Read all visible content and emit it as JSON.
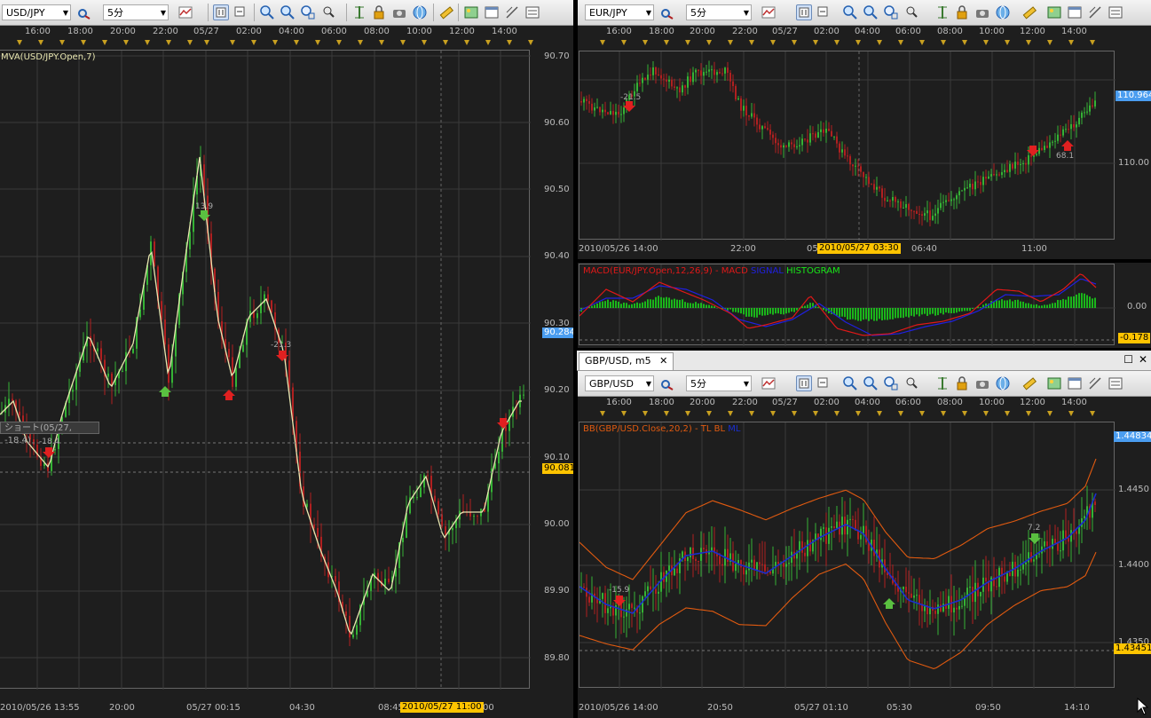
{
  "colors": {
    "up": "#35b335",
    "down": "#b02020",
    "ma": "#e8e6b0",
    "bb_band": "#e05a10",
    "bb_mid": "#1a2ed0",
    "macd": "#e01818",
    "signal": "#2020e0",
    "histogram": "#18e818",
    "tag_blue": "#4a9df0",
    "tag_yellow": "#ffc400"
  },
  "left": {
    "symbol": "USD/JPY",
    "timeframe": "5分",
    "indicator": "MVA(USD/JPY.Open,7)",
    "top_times": [
      "16:00",
      "18:00",
      "20:00",
      "22:00",
      "05/27",
      "02:00",
      "04:00",
      "06:00",
      "08:00",
      "10:00",
      "12:00",
      "14:00"
    ],
    "price_ticks": [
      "90.70",
      "90.60",
      "90.50",
      "90.40",
      "90.30",
      "90.20",
      "90.10",
      "90.00",
      "89.90",
      "89.80"
    ],
    "price_tag_blue": "90.284",
    "price_tag_yellow": "90.081",
    "bottom_times": [
      "2010/05/26 13:55",
      "20:00",
      "05/27 00:15",
      "04:30",
      "08:45"
    ],
    "cursor_time": "2010/05/27 11:00",
    "cursor_time_tail": "00",
    "tooltip": "ショート(05/27, -18.4)",
    "tooltip_prefix": "S",
    "signals": [
      {
        "label": "-18.4"
      },
      {
        "label": "13.9"
      },
      {
        "label": "-21.3"
      }
    ]
  },
  "right_top": {
    "symbol": "EUR/JPY",
    "timeframe": "5分",
    "top_times": [
      "16:00",
      "18:00",
      "20:00",
      "22:00",
      "05/27",
      "02:00",
      "04:00",
      "06:00",
      "08:00",
      "10:00",
      "12:00",
      "14:00"
    ],
    "price_ticks": [
      "110.00"
    ],
    "price_tag_blue": "110.964",
    "bottom_times": [
      "2010/05/26 14:00",
      "22:00",
      "05",
      "06:40",
      "11:00"
    ],
    "cursor_time": "2010/05/27 03:30",
    "signals": [
      {
        "label": "-21.5"
      },
      {
        "label": "68.1"
      }
    ],
    "macd_legend": {
      "title": "MACD(EUR/JPY.Open,12,26,9) -",
      "macd": "MACD",
      "signal": "SIGNAL",
      "histogram": "HISTOGRAM"
    },
    "macd_zero": "0.00",
    "macd_tag": "-0.178"
  },
  "right_bottom": {
    "tab_label": "GBP/USD, m5",
    "symbol": "GBP/USD",
    "timeframe": "5分",
    "indicator": {
      "title": "BB(GBP/USD.Close,20,2) -",
      "tl": "TL",
      "bl": "BL",
      "ml": "ML"
    },
    "top_times": [
      "16:00",
      "18:00",
      "20:00",
      "22:00",
      "05/27",
      "02:00",
      "04:00",
      "06:00",
      "08:00",
      "10:00",
      "12:00",
      "14:00"
    ],
    "price_ticks": [
      "1.4450",
      "1.4400",
      "1.4350"
    ],
    "price_tag_blue": "1.44834",
    "price_tag_yellow": "1.43451",
    "bottom_times": [
      "2010/05/26 14:00",
      "20:50",
      "05/27 01:10",
      "05:30",
      "09:50",
      "14:10"
    ],
    "signals": [
      {
        "label": "-15.9"
      },
      {
        "label": "7.2"
      }
    ]
  }
}
